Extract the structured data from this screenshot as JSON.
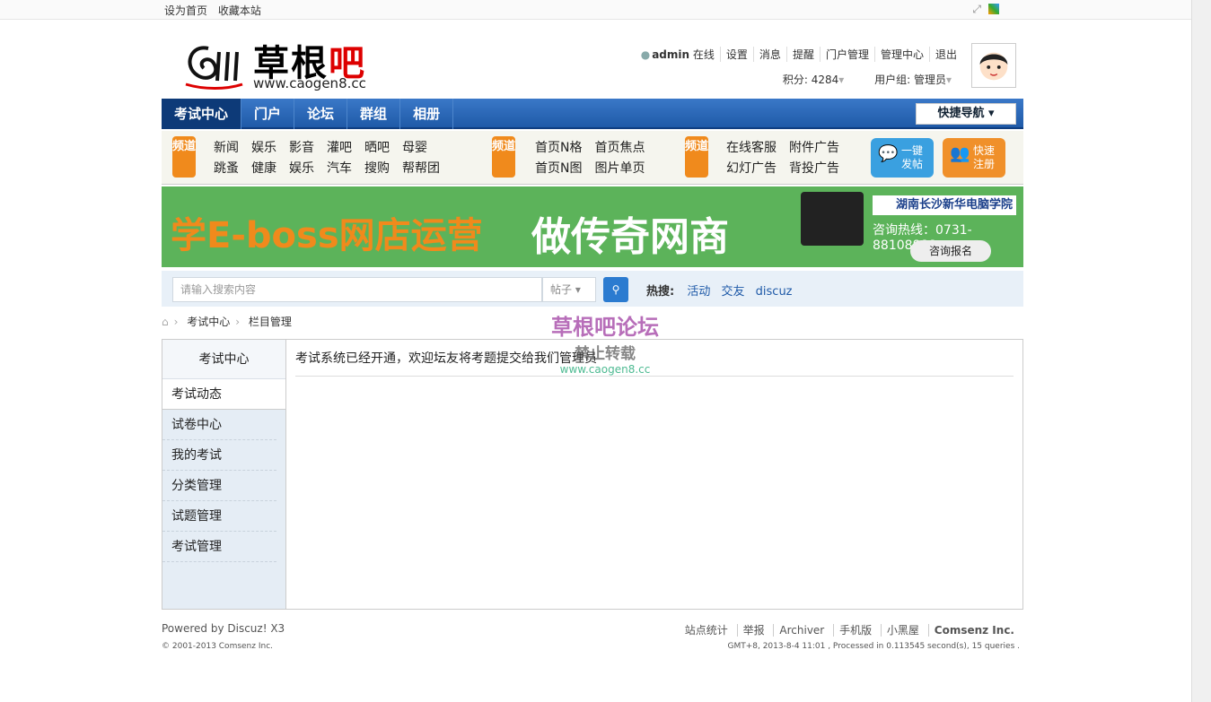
{
  "topbar": {
    "links": [
      "设为首页",
      "收藏本站"
    ]
  },
  "logo": {
    "cn_main": "草根",
    "cn_red": "吧",
    "url": "www.caogen8.cc"
  },
  "user": {
    "name": "admin",
    "status": "在线",
    "menu": [
      "设置",
      "消息",
      "提醒",
      "门户管理",
      "管理中心",
      "退出"
    ],
    "points": "积分: 4284",
    "group": "用户组: 管理员"
  },
  "nav": {
    "items": [
      "考试中心",
      "门户",
      "论坛",
      "群组",
      "相册"
    ],
    "quick": "快捷导航"
  },
  "channels": {
    "badge": "频道",
    "g1": [
      "新闻",
      "跳蚤",
      "娱乐",
      "健康",
      "影音",
      "娱乐",
      "灌吧",
      "汽车",
      "晒吧",
      "搜购",
      "母婴",
      "帮帮团"
    ],
    "g2": [
      "首页N格",
      "首页N图",
      "首页焦点",
      "图片单页"
    ],
    "g3": [
      "在线客服",
      "幻灯广告",
      "附件广告",
      "背投广告"
    ],
    "btn1": "一键发帖",
    "btn2": "快速注册"
  },
  "banner": {
    "t1": "学E-boss网店运营",
    "t2": "做传奇网商",
    "school": "湖南长沙新华电脑学院",
    "hotline": "咨询热线：0731-88108888",
    "reg": "咨询报名"
  },
  "search": {
    "placeholder": "请输入搜索内容",
    "type": "帖子",
    "hot_label": "热搜:",
    "hot": [
      "活动",
      "交友",
      "discuz"
    ]
  },
  "crumb": [
    "考试中心",
    "栏目管理"
  ],
  "side": {
    "head": "考试中心",
    "items": [
      "考试动态",
      "试卷中心",
      "我的考试",
      "分类管理",
      "试题管理",
      "考试管理"
    ]
  },
  "content": {
    "text": "考试系统已经开通，欢迎坛友将考题提交给我们管理员"
  },
  "watermark": {
    "a": "草根吧论坛",
    "b": "禁止转载",
    "c": "www.caogen8.cc"
  },
  "footer": {
    "powered": "Powered by Discuz! X3",
    "copy": "© 2001-2013 Comsenz Inc.",
    "links": [
      "站点统计",
      "举报",
      "Archiver",
      "手机版",
      "小黑屋",
      "Comsenz Inc."
    ],
    "stat": "GMT+8, 2013-8-4 11:01 , Processed in 0.113545 second(s), 15 queries ."
  }
}
